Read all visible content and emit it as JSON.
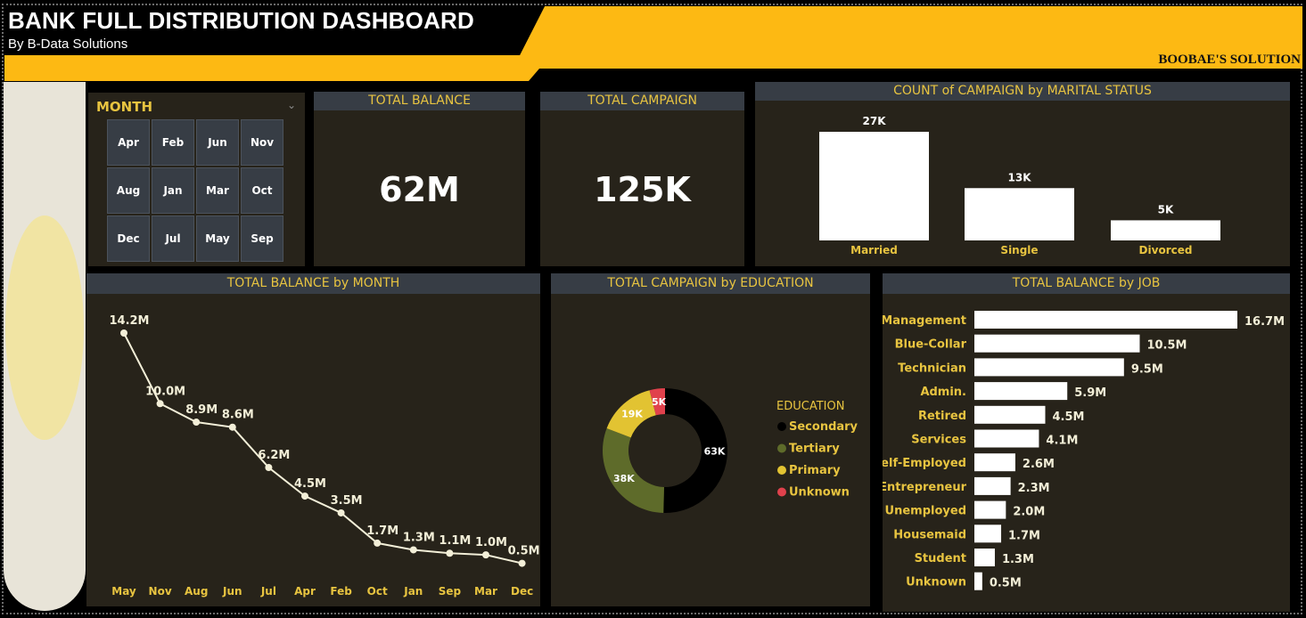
{
  "header": {
    "title": "BANK FULL DISTRIBUTION DASHBOARD",
    "subtitle": "By B-Data Solutions",
    "brand": "BOOBAE'S SOLUTION"
  },
  "colors": {
    "banner_yellow": "#fdb913",
    "panel_bg": "#27231a",
    "header_bg": "#373d45",
    "accent_text": "#e8c440",
    "secondary": "#000000",
    "tertiary": "#5e6b2a",
    "primary": "#e2c332",
    "unknown": "#e0414c"
  },
  "slicer": {
    "title": "MONTH",
    "months": [
      "Apr",
      "Feb",
      "Jun",
      "Nov",
      "Aug",
      "Jan",
      "Mar",
      "Oct",
      "Dec",
      "Jul",
      "May",
      "Sep"
    ]
  },
  "kpis": {
    "total_balance": {
      "title": "TOTAL BALANCE",
      "value": "62M"
    },
    "total_campaign": {
      "title": "TOTAL CAMPAIGN",
      "value": "125K"
    }
  },
  "chart_data": [
    {
      "type": "bar",
      "title": "COUNT of CAMPAIGN by MARITAL STATUS",
      "categories": [
        "Married",
        "Single",
        "Divorced"
      ],
      "values": [
        27000,
        13000,
        5000
      ],
      "labels": [
        "27K",
        "13K",
        "5K"
      ]
    },
    {
      "type": "line",
      "title": "TOTAL BALANCE by MONTH",
      "categories": [
        "May",
        "Nov",
        "Aug",
        "Jun",
        "Jul",
        "Apr",
        "Feb",
        "Oct",
        "Jan",
        "Sep",
        "Mar",
        "Dec"
      ],
      "values": [
        14.2,
        10.0,
        8.9,
        8.6,
        6.2,
        4.5,
        3.5,
        1.7,
        1.3,
        1.1,
        1.0,
        0.5
      ],
      "labels": [
        "14.2M",
        "10.0M",
        "8.9M",
        "8.6M",
        "6.2M",
        "4.5M",
        "3.5M",
        "1.7M",
        "1.3M",
        "1.1M",
        "1.0M",
        "0.5M"
      ]
    },
    {
      "type": "pie",
      "title": "TOTAL CAMPAIGN by EDUCATION",
      "legend_title": "EDUCATION",
      "categories": [
        "Secondary",
        "Tertiary",
        "Primary",
        "Unknown"
      ],
      "values": [
        63,
        38,
        19,
        5
      ],
      "labels": [
        "63K",
        "38K",
        "19K",
        "5K"
      ]
    },
    {
      "type": "bar",
      "orientation": "horizontal",
      "title": "TOTAL BALANCE by JOB",
      "categories": [
        "Management",
        "Blue-Collar",
        "Technician",
        "Admin.",
        "Retired",
        "Services",
        "Self-Employed",
        "Entrepreneur",
        "Unemployed",
        "Housemaid",
        "Student",
        "Unknown"
      ],
      "values": [
        16.7,
        10.5,
        9.5,
        5.9,
        4.5,
        4.1,
        2.6,
        2.3,
        2.0,
        1.7,
        1.3,
        0.5
      ],
      "labels": [
        "16.7M",
        "10.5M",
        "9.5M",
        "5.9M",
        "4.5M",
        "4.1M",
        "2.6M",
        "2.3M",
        "2.0M",
        "1.7M",
        "1.3M",
        "0.5M"
      ]
    }
  ]
}
